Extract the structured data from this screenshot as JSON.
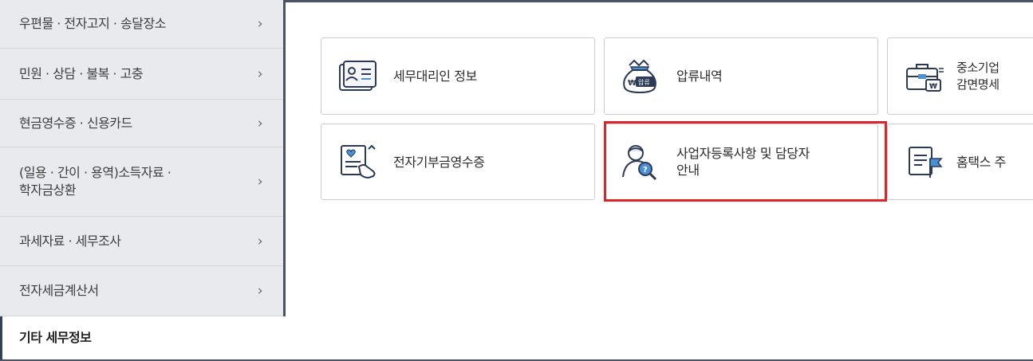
{
  "sidebar": {
    "items": [
      {
        "label": "우편물 · 전자고지 · 송달장소",
        "chevron": "›"
      },
      {
        "label": "민원 · 상담 · 불복 · 고충",
        "chevron": "›"
      },
      {
        "label": "현금영수증 · 신용카드",
        "chevron": "›"
      },
      {
        "label": "(일용 · 간이 · 용역)소득자료 ·\n학자금상환",
        "chevron": "›"
      },
      {
        "label": "과세자료 · 세무조사",
        "chevron": "›"
      },
      {
        "label": "전자세금계산서",
        "chevron": "›"
      }
    ],
    "active_label": "기타 세무정보"
  },
  "cards": [
    {
      "label": "세무대리인 정보",
      "icon": "tax-agent-card-icon"
    },
    {
      "label": "압류내역",
      "icon": "seizure-money-bag-icon",
      "icon_text": "압류"
    },
    {
      "label": "중소기업\n감면명세",
      "icon": "briefcase-icon"
    },
    {
      "label": "전자기부금영수증",
      "icon": "donation-receipt-icon"
    },
    {
      "label": "사업자등록사항 및 담당자\n안내",
      "icon": "person-search-icon"
    },
    {
      "label": "홈택스 주",
      "icon": "document-flag-icon"
    }
  ],
  "colors": {
    "sidebar_bg": "#e9eaed",
    "frame": "#4a5366",
    "highlight": "#e0232b",
    "icon_stroke": "#2d3a55",
    "icon_accent": "#4a90d9"
  }
}
